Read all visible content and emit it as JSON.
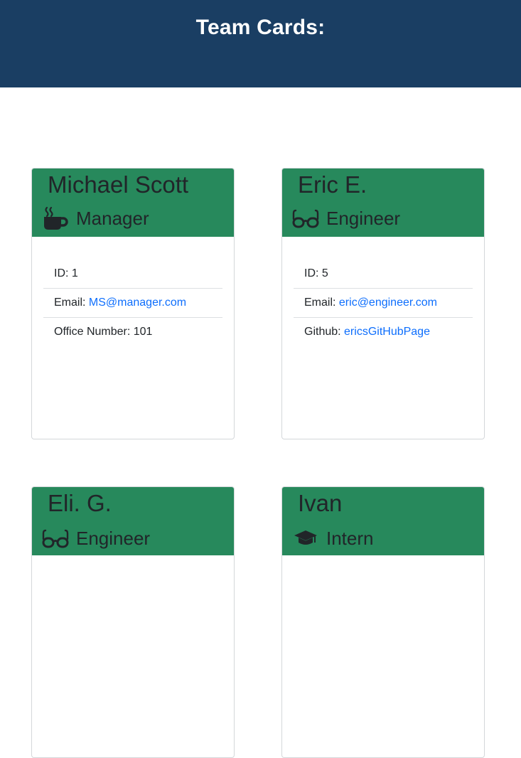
{
  "header": {
    "title": "Team Cards:"
  },
  "cards": [
    {
      "name": "Michael Scott",
      "role": "Manager",
      "icon": "coffee-icon",
      "id_label": "ID: ",
      "id_value": "1",
      "email_label": "Email: ",
      "email": "MS@manager.com",
      "extra_label": "Office Number: ",
      "extra_value": "101"
    },
    {
      "name": "Eric E.",
      "role": "Engineer",
      "icon": "glasses-icon",
      "id_label": "ID: ",
      "id_value": "5",
      "email_label": "Email: ",
      "email": "eric@engineer.com",
      "extra_label": "Github: ",
      "extra_value": "ericsGitHubPage"
    },
    {
      "name": "Eli. G.",
      "role": "Engineer",
      "icon": "glasses-icon"
    },
    {
      "name": "Ivan",
      "role": "Intern",
      "icon": "graduation-cap-icon"
    }
  ],
  "colors": {
    "header_bg": "#1a3e63",
    "card_header_bg": "#27895c",
    "link": "#0d6efd"
  }
}
